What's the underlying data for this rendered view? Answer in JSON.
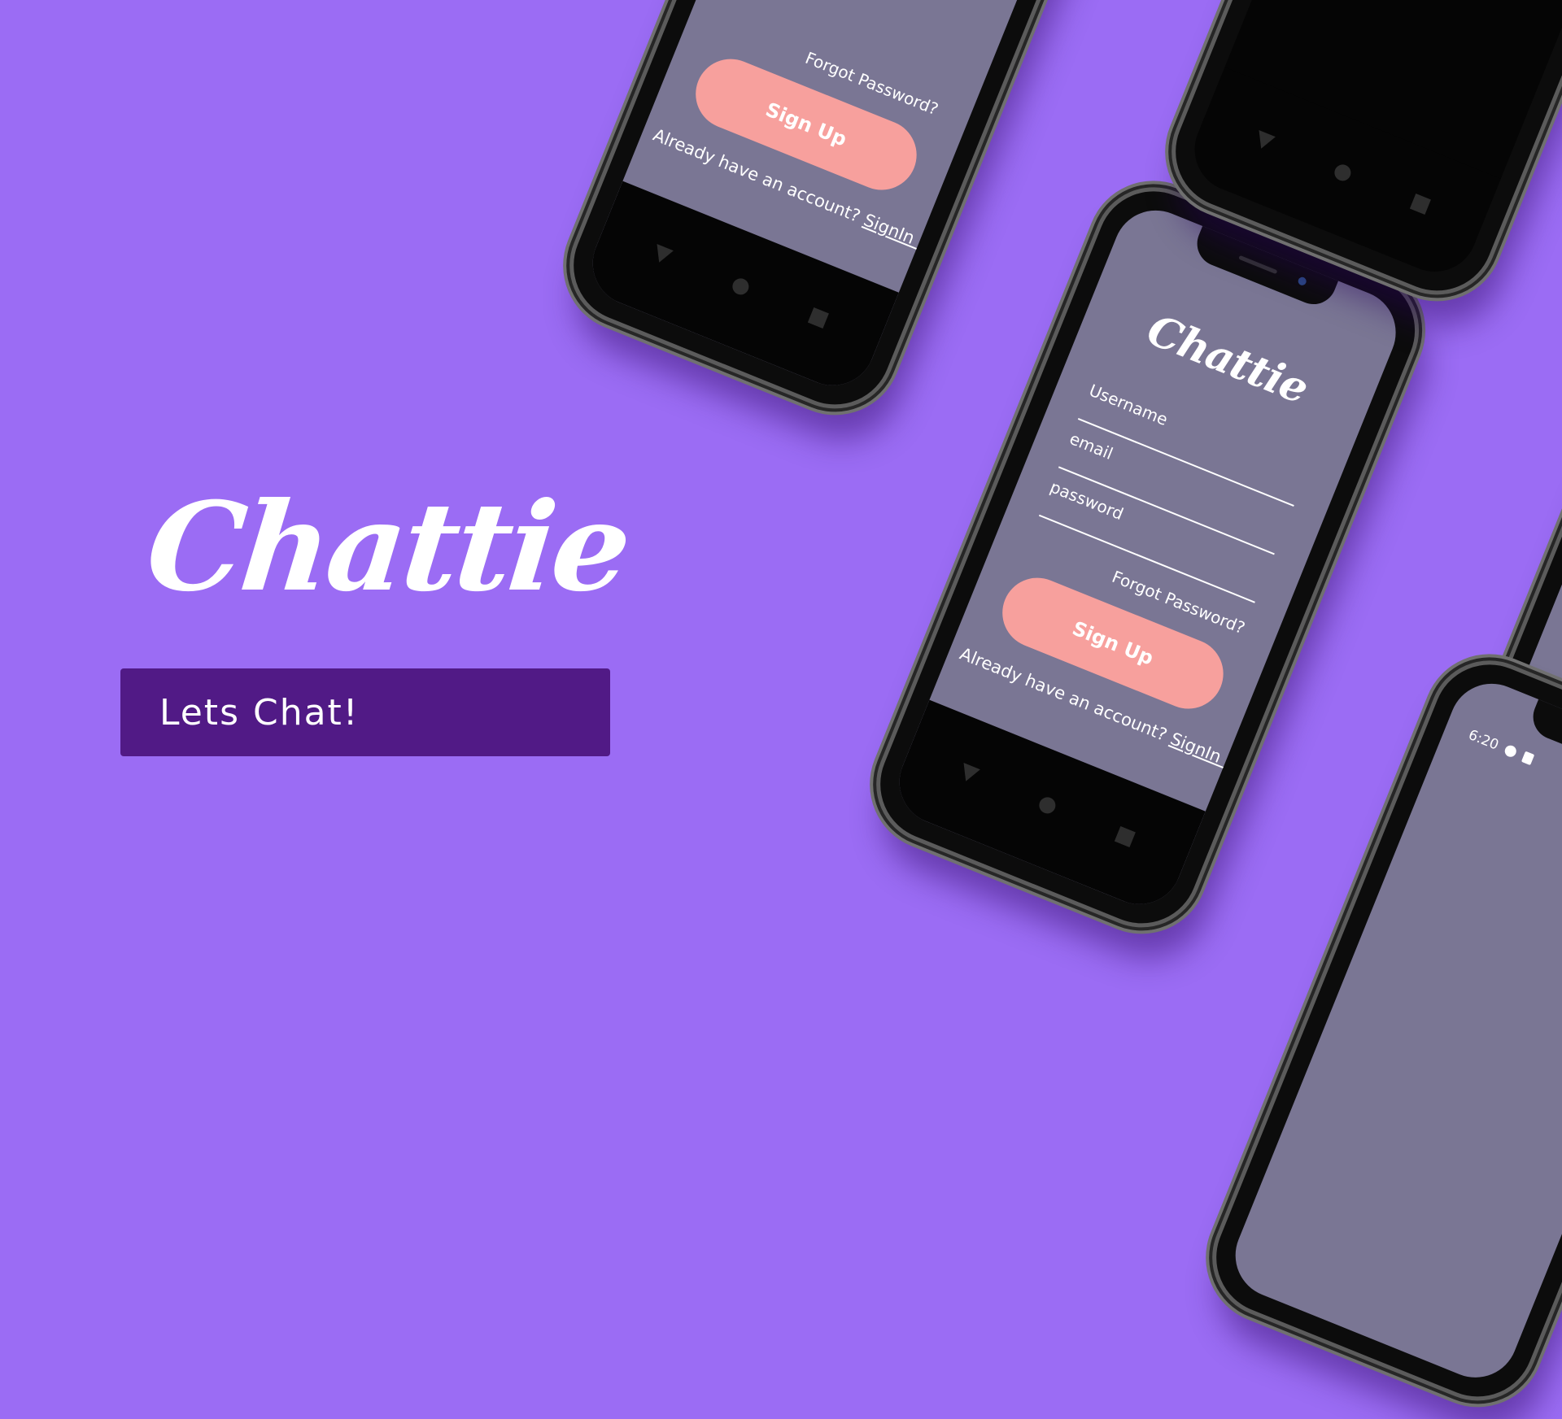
{
  "brand": {
    "name": "Chattie",
    "tagline": "Lets Chat!"
  },
  "form": {
    "username_placeholder": "Username",
    "email_placeholder": "email",
    "password_placeholder": "password",
    "forgot_label": "Forgot Password?",
    "signup_label": "Sign Up",
    "already_label": "Already have an account? ",
    "signin_label": "SignIn now"
  },
  "top_phone": {
    "forgot_label": "Forgot Password?",
    "signup_label": "Sign Up",
    "already_label": "Already have an account? ",
    "signin_label": "SignIn now"
  },
  "status_bar": {
    "time": "6:20"
  },
  "colors": {
    "background": "#9b6cf4",
    "cta": "#511a86",
    "screen": "#7a7694",
    "button": "#f7a09d"
  }
}
